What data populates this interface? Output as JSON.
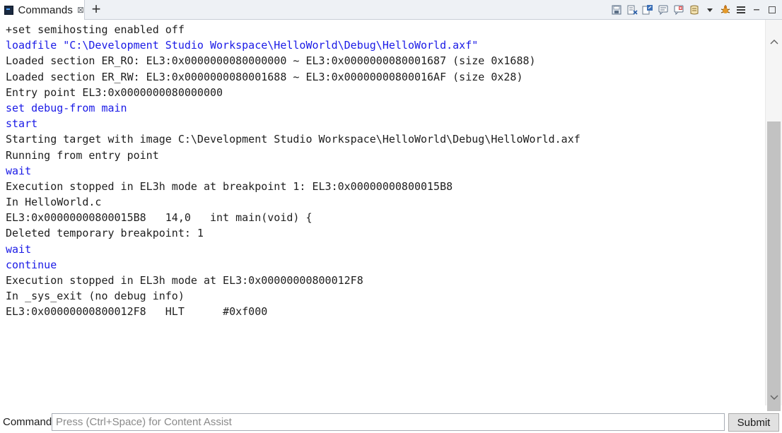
{
  "tab": {
    "label": "Commands",
    "close_glyph": "⊠",
    "add_glyph": "+"
  },
  "toolbar": {
    "icons": [
      "save-log-icon",
      "clear-console-icon",
      "export-icon",
      "new-script-icon",
      "script-run-icon",
      "history-icon",
      "dropdown-arrow-icon",
      "debug-icon",
      "menu-icon",
      "minimize-icon",
      "maximize-icon"
    ]
  },
  "console": {
    "lines": [
      {
        "text": "+set semihosting enabled off",
        "kind": "out"
      },
      {
        "text": "loadfile \"C:\\Development Studio Workspace\\HelloWorld\\Debug\\HelloWorld.axf\"",
        "kind": "cmd"
      },
      {
        "text": "Loaded section ER_RO: EL3:0x0000000080000000 ~ EL3:0x0000000080001687 (size 0x1688)",
        "kind": "out"
      },
      {
        "text": "Loaded section ER_RW: EL3:0x0000000080001688 ~ EL3:0x00000000800016AF (size 0x28)",
        "kind": "out"
      },
      {
        "text": "Entry point EL3:0x0000000080000000",
        "kind": "out"
      },
      {
        "text": "set debug-from main",
        "kind": "cmd"
      },
      {
        "text": "start",
        "kind": "cmd"
      },
      {
        "text": "Starting target with image C:\\Development Studio Workspace\\HelloWorld\\Debug\\HelloWorld.axf",
        "kind": "out"
      },
      {
        "text": "Running from entry point",
        "kind": "out"
      },
      {
        "text": "wait",
        "kind": "cmd"
      },
      {
        "text": "Execution stopped in EL3h mode at breakpoint 1: EL3:0x00000000800015B8",
        "kind": "out"
      },
      {
        "text": "In HelloWorld.c",
        "kind": "out"
      },
      {
        "text": "EL3:0x00000000800015B8   14,0   int main(void) {",
        "kind": "out"
      },
      {
        "text": "Deleted temporary breakpoint: 1",
        "kind": "out"
      },
      {
        "text": "wait",
        "kind": "cmd"
      },
      {
        "text": "continue",
        "kind": "cmd"
      },
      {
        "text": "Execution stopped in EL3h mode at EL3:0x00000000800012F8",
        "kind": "out"
      },
      {
        "text": "In _sys_exit (no debug info)",
        "kind": "out"
      },
      {
        "text": "EL3:0x00000000800012F8   HLT      #0xf000",
        "kind": "out"
      }
    ],
    "colors": {
      "command": "#1a1ae6",
      "output": "#1e1e1e"
    }
  },
  "command_bar": {
    "label": "Command:",
    "placeholder": "Press (Ctrl+Space) for Content Assist",
    "value": "",
    "submit_label": "Submit"
  }
}
